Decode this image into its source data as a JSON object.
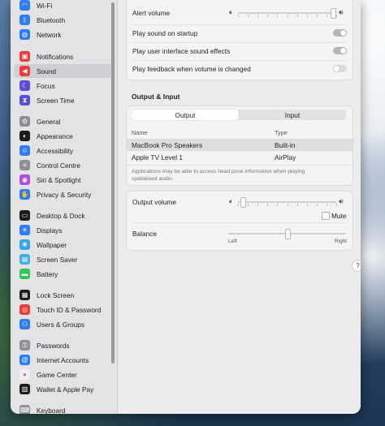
{
  "sidebar": {
    "items": [
      {
        "label": "Wi-Fi",
        "icon": "wifi-icon",
        "color": "#2f7cf6",
        "glyph": "◠"
      },
      {
        "label": "Bluetooth",
        "icon": "bluetooth-icon",
        "color": "#2f7cf6",
        "glyph": "ᛒ"
      },
      {
        "label": "Network",
        "icon": "globe-icon",
        "color": "#2f7cf6",
        "glyph": "◍"
      },
      {
        "label": "Notifications",
        "icon": "bell-icon",
        "color": "#ec3b3b",
        "glyph": "▣"
      },
      {
        "label": "Sound",
        "icon": "speaker-icon",
        "color": "#ec3b3b",
        "glyph": "◀"
      },
      {
        "label": "Focus",
        "icon": "moon-icon",
        "color": "#5a4fd6",
        "glyph": "☾"
      },
      {
        "label": "Screen Time",
        "icon": "hourglass-icon",
        "color": "#5a4fd6",
        "glyph": "⧗"
      },
      {
        "label": "General",
        "icon": "gear-icon",
        "color": "#8e8e93",
        "glyph": "⚙"
      },
      {
        "label": "Appearance",
        "icon": "appearance-icon",
        "color": "#1c1c1e",
        "glyph": "◐"
      },
      {
        "label": "Accessibility",
        "icon": "accessibility-icon",
        "color": "#2f7cf6",
        "glyph": "☺"
      },
      {
        "label": "Control Centre",
        "icon": "control-centre-icon",
        "color": "#8e8e93",
        "glyph": "≡"
      },
      {
        "label": "Siri & Spotlight",
        "icon": "siri-icon",
        "color": "#b24be0",
        "glyph": "◉"
      },
      {
        "label": "Privacy & Security",
        "icon": "hand-icon",
        "color": "#2f7cf6",
        "glyph": "✋"
      },
      {
        "label": "Desktop & Dock",
        "icon": "dock-icon",
        "color": "#1c1c1e",
        "glyph": "▭"
      },
      {
        "label": "Displays",
        "icon": "display-icon",
        "color": "#2f7cf6",
        "glyph": "☀"
      },
      {
        "label": "Wallpaper",
        "icon": "wallpaper-icon",
        "color": "#35a7e8",
        "glyph": "❋"
      },
      {
        "label": "Screen Saver",
        "icon": "screen-saver-icon",
        "color": "#3fb0e0",
        "glyph": "▤"
      },
      {
        "label": "Battery",
        "icon": "battery-icon",
        "color": "#34c759",
        "glyph": "▬"
      },
      {
        "label": "Lock Screen",
        "icon": "lock-icon",
        "color": "#1c1c1e",
        "glyph": "▦"
      },
      {
        "label": "Touch ID & Password",
        "icon": "fingerprint-icon",
        "color": "#ec3b3b",
        "glyph": "◎"
      },
      {
        "label": "Users & Groups",
        "icon": "users-icon",
        "color": "#2f7cf6",
        "glyph": "⚇"
      },
      {
        "label": "Passwords",
        "icon": "key-icon",
        "color": "#8e8e93",
        "glyph": "⚿"
      },
      {
        "label": "Internet Accounts",
        "icon": "at-icon",
        "color": "#2f7cf6",
        "glyph": "@"
      },
      {
        "label": "Game Center",
        "icon": "game-center-icon",
        "color": "#f0f0f0",
        "glyph": "●"
      },
      {
        "label": "Wallet & Apple Pay",
        "icon": "wallet-icon",
        "color": "#1c1c1e",
        "glyph": "▥"
      },
      {
        "label": "Keyboard",
        "icon": "keyboard-icon",
        "color": "#8e8e93",
        "glyph": "⌨"
      }
    ],
    "selected": "Sound"
  },
  "sound_effects": {
    "alert_volume_label": "Alert volume",
    "alert_volume_level": 0.97,
    "startup_label": "Play sound on startup",
    "startup_on": true,
    "ui_effects_label": "Play user interface sound effects",
    "ui_effects_on": true,
    "feedback_label": "Play feedback when volume is changed",
    "feedback_on": false
  },
  "output_input": {
    "title": "Output & Input",
    "tabs": [
      "Output",
      "Input"
    ],
    "selected_tab": "Output",
    "columns": [
      "Name",
      "Type"
    ],
    "devices": [
      {
        "name": "MacBook Pro Speakers",
        "type": "Built-in"
      },
      {
        "name": "Apple TV Level 1",
        "type": "AirPlay"
      }
    ],
    "note": "Applications may be able to access head pose information when playing spatialised audio."
  },
  "output": {
    "volume_label": "Output volume",
    "volume_level": 0.05,
    "mute_label": "Mute",
    "muted": false,
    "balance_label": "Balance",
    "balance_level": 0.5,
    "left_label": "Left",
    "right_label": "Right"
  },
  "help": "?"
}
